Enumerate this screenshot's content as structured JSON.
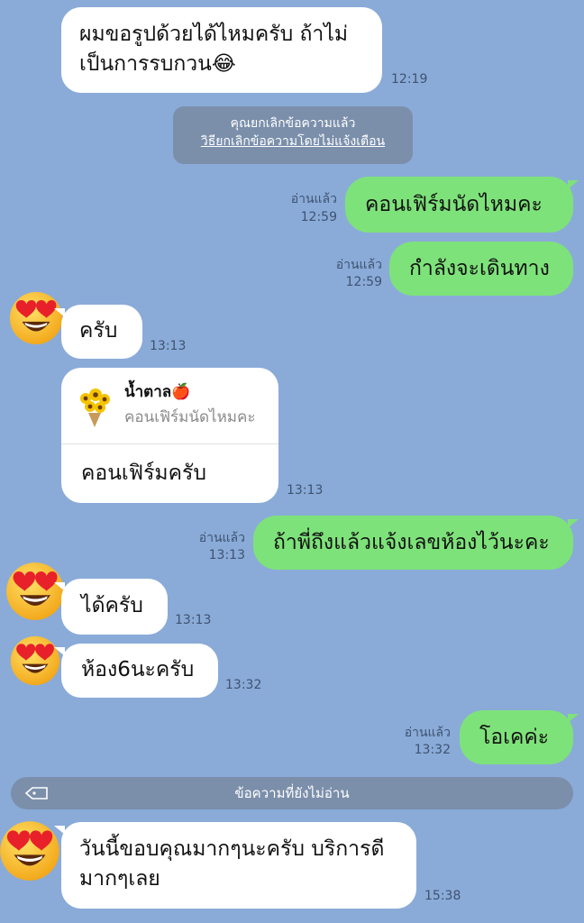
{
  "messages": {
    "m1": {
      "text_line1": "ผมขอรูปด้วยได้ไหมครับ ถ้าไม่",
      "text_line2": "เป็นการรบกวน😂",
      "time": "12:19"
    },
    "unsend_notice": {
      "text": "คุณยกเลิกข้อความแล้ว",
      "link": "วิธียกเลิกข้อความโดยไม่แจ้งเตือน"
    },
    "m2": {
      "text": "คอนเฟิร์มนัดไหมคะ",
      "read": "อ่านแล้ว",
      "time": "12:59"
    },
    "m3": {
      "text": "กำลังจะเดินทาง",
      "read": "อ่านแล้ว",
      "time": "12:59"
    },
    "m4": {
      "text": "ครับ",
      "time": "13:13"
    },
    "m5": {
      "reply_name": "น้ำตาล🍎",
      "reply_quote": "คอนเฟิร์มนัดไหมคะ",
      "text": "คอนเฟิร์มครับ",
      "time": "13:13"
    },
    "m6": {
      "text": "ถ้าพี่ถึงแล้วแจ้งเลขห้องไว้นะคะ",
      "read": "อ่านแล้ว",
      "time": "13:13"
    },
    "m7": {
      "text": "ได้ครับ",
      "time": "13:13"
    },
    "m8": {
      "text": "ห้อง6นะครับ",
      "time": "13:32"
    },
    "m9": {
      "text": "โอเคค่ะ",
      "read": "อ่านแล้ว",
      "time": "13:32"
    },
    "unread_divider": {
      "text": "ข้อความที่ยังไม่อ่าน"
    },
    "m10": {
      "text_line1": "วันนี้ขอบคุณมากๆนะครับ บริการดี",
      "text_line2": "มากๆเลย",
      "time": "15:38"
    }
  },
  "colors": {
    "background": "#8aabd8",
    "outgoing": "#7ee27a",
    "incoming": "#ffffff",
    "system": "#7b8fab"
  },
  "icons": {
    "avatar": "heart-eyes-emoji-icon",
    "reply_avatar": "sunflower-bouquet-icon",
    "divider": "tag-icon"
  }
}
